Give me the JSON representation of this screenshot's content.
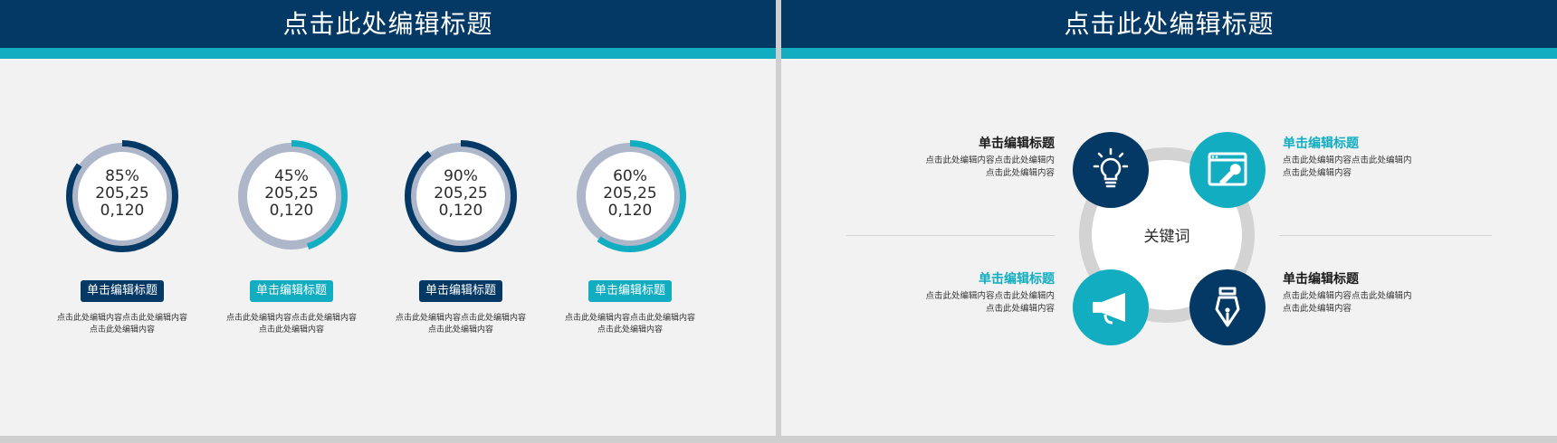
{
  "left_slide": {
    "title": "点击此处编辑标题",
    "items": [
      {
        "percent": 85,
        "label_pct": "85%",
        "line2": "205,25",
        "line3": "0,120",
        "tag": "单击编辑标题",
        "desc1": "点击此处编辑内容点击此处编辑内容",
        "desc2": "点击此处编辑内容",
        "color": "#043965"
      },
      {
        "percent": 45,
        "label_pct": "45%",
        "line2": "205,25",
        "line3": "0,120",
        "tag": "单击编辑标题",
        "desc1": "点击此处编辑内容点击此处编辑内容",
        "desc2": "点击此处编辑内容",
        "color": "#12adc1"
      },
      {
        "percent": 90,
        "label_pct": "90%",
        "line2": "205,25",
        "line3": "0,120",
        "tag": "单击编辑标题",
        "desc1": "点击此处编辑内容点击此处编辑内容",
        "desc2": "点击此处编辑内容",
        "color": "#043965"
      },
      {
        "percent": 60,
        "label_pct": "60%",
        "line2": "205,25",
        "line3": "0,120",
        "tag": "单击编辑标题",
        "desc1": "点击此处编辑内容点击此处编辑内容",
        "desc2": "点击此处编辑内容",
        "color": "#12adc1"
      }
    ]
  },
  "right_slide": {
    "title": "点击此处编辑标题",
    "center": "关键词",
    "blocks": [
      {
        "title": "单击编辑标题",
        "desc1": "点击此处编辑内容点击此处编辑内",
        "desc2": "点击此处编辑内容",
        "icon": "lightbulb-icon"
      },
      {
        "title": "单击编辑标题",
        "desc1": "点击此处编辑内容点击此处编辑内",
        "desc2": "点击此处编辑内容",
        "icon": "window-wrench-icon"
      },
      {
        "title": "单击编辑标题",
        "desc1": "点击此处编辑内容点击此处编辑内",
        "desc2": "点击此处编辑内容",
        "icon": "megaphone-icon"
      },
      {
        "title": "单击编辑标题",
        "desc1": "点击此处编辑内容点击此处编辑内",
        "desc2": "点击此处编辑内容",
        "icon": "pen-nib-icon"
      }
    ]
  },
  "colors": {
    "navy": "#043965",
    "teal": "#12adc1",
    "ring_gray": "#aeb7c9",
    "background": "#f2f2f3"
  }
}
